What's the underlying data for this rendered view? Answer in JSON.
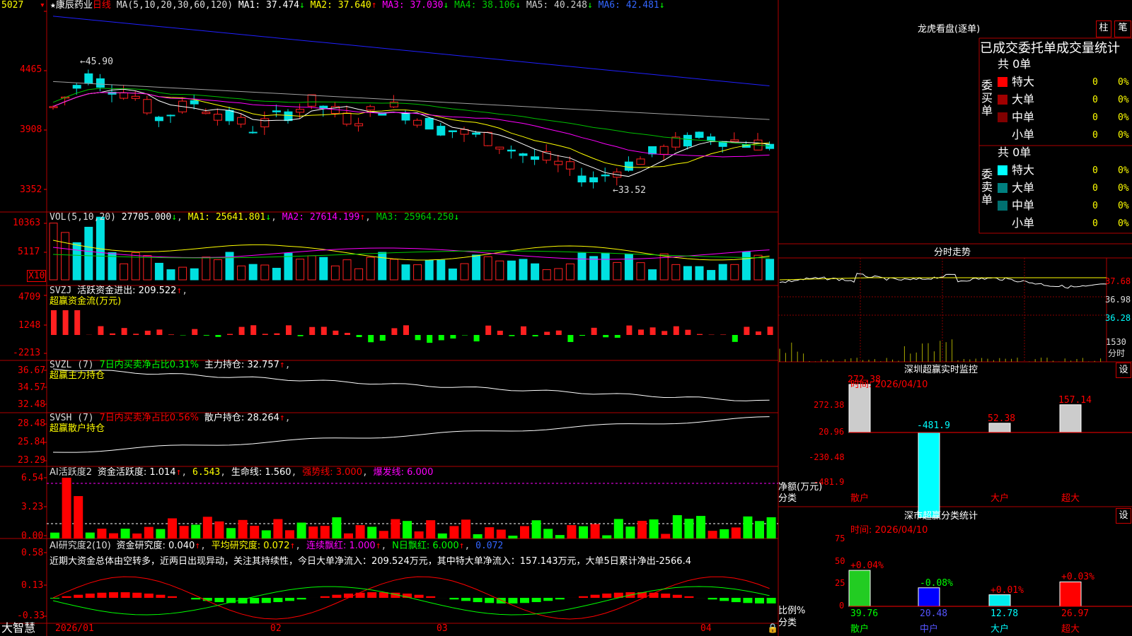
{
  "colors": {
    "up": "#ff2020",
    "down": "#00e0e0",
    "green": "#00ff00",
    "grid": "#b00000",
    "ma1": "#ffffff",
    "ma2": "#ffff00",
    "ma3": "#ff00ff",
    "ma4": "#00c000",
    "ma5": "#a0a0a0",
    "ma6": "#2020ff"
  },
  "header": {
    "star": "★",
    "stock_name": "康辰药业",
    "period": "日线",
    "ma_text": "MA(5,10,20,30,60,120)",
    "ma": [
      {
        "label": "MA1: 37.474",
        "arrow": "↓"
      },
      {
        "label": "MA2: 37.640",
        "arrow": "↑"
      },
      {
        "label": "MA3: 37.030",
        "arrow": "↓"
      },
      {
        "label": "MA4: 38.106",
        "arrow": "↓"
      },
      {
        "label": "MA5: 40.248",
        "arrow": "↓"
      },
      {
        "label": "MA6: 42.481",
        "arrow": "↓"
      }
    ]
  },
  "price_axis": [
    "5027",
    "4465",
    "3908",
    "3352"
  ],
  "price_annotations": {
    "high": "45.90",
    "low": "33.52"
  },
  "vol": {
    "title": "VOL(5,10,20)",
    "value": "27705.000",
    "arrow": "↓",
    "ma1": "MA1: 25641.801",
    "ma2": "MA2: 27614.199",
    "ma3": "MA3: 25964.250",
    "axis": [
      "10363",
      "5117"
    ],
    "unit": "X10"
  },
  "svzj": {
    "title": "SVZJ",
    "text": "活跃资金进出: 209.522",
    "arrow": "↑",
    "sub": "超赢资金流(万元)",
    "axis": [
      "4709",
      "1248",
      "-2213"
    ]
  },
  "svzl": {
    "title": "SVZL (7)",
    "ratio": "7日内买卖净占比0.31%",
    "text": "主力持仓: 32.757",
    "sub": "超赢主力持仓",
    "axis": [
      "36.67",
      "34.57",
      "32.48"
    ]
  },
  "svsh": {
    "title": "SVSH (7)",
    "ratio": "7日内买卖净占比0.56%",
    "text": "散户持仓: 28.264",
    "sub": "超赢散户持仓",
    "axis": [
      "28.48",
      "25.84",
      "23.29"
    ]
  },
  "ai_active": {
    "title": "AI活跃度2",
    "text": "资金活跃度: 1.014",
    "v2": "6.543",
    "life": "生命线: 1.560",
    "strong": "强势线: 3.000",
    "burst": "爆发线: 6.000",
    "axis": [
      "6.54",
      "3.23",
      "0.00"
    ]
  },
  "ai_research": {
    "title": "AI研究度2(10)",
    "text": "资金研究度: 0.040",
    "avg": "平均研究度: 0.072",
    "cont": "连续飘红: 1.000",
    "nday": "N日飘红: 6.000",
    "last": "0.072",
    "axis": [
      "0.58",
      "0.13",
      "-0.33"
    ],
    "comment": "近期大资金总体由空转多，近两日出现异动，关注其持续性，今日大单净流入：209.524万元，其中特大单净流入：157.143万元，大单5日累计净出-2566.4"
  },
  "bottom": {
    "logo": "大智慧",
    "dates": [
      "2026/01",
      "02",
      "03",
      "04"
    ]
  },
  "right": {
    "lhb_title": "龙虎看盘(逐单)",
    "btn_zhu": "柱",
    "btn_bi": "笔",
    "stat_title": "已成交委托单成交量统计",
    "buy": {
      "side": "委买单",
      "total": "共 0单",
      "rows": [
        {
          "name": "特大",
          "v": "0",
          "p": "0%",
          "c": "#ff0000"
        },
        {
          "name": "大单",
          "v": "0",
          "p": "0%",
          "c": "#a00000"
        },
        {
          "name": "中单",
          "v": "0",
          "p": "0%",
          "c": "#800000"
        },
        {
          "name": "小单",
          "v": "0",
          "p": "0%",
          "c": "#000000"
        }
      ]
    },
    "sell": {
      "side": "委卖单",
      "total": "共 0单",
      "rows": [
        {
          "name": "特大",
          "v": "0",
          "p": "0%",
          "c": "#00ffff"
        },
        {
          "name": "大单",
          "v": "0",
          "p": "0%",
          "c": "#008080"
        },
        {
          "name": "中单",
          "v": "0",
          "p": "0%",
          "c": "#007070"
        },
        {
          "name": "小单",
          "v": "0",
          "p": "0%",
          "c": "#000000"
        }
      ]
    },
    "fs_title": "分时走势",
    "fs_axis": [
      "37.68",
      "36.98",
      "36.28"
    ],
    "fs_vol": "1530",
    "fs_unit": "分时",
    "sz_title": "深圳超赢实时监控",
    "btn_set": "设",
    "time": "时间: 2026/04/10",
    "sz_axis": [
      "272.38",
      "20.96",
      "-230.48",
      "-481.9"
    ],
    "sz_unit1": "净额(万元)",
    "sz_unit2": "分类",
    "cls_title": "深市超赢分类统计",
    "cls_axis": [
      "75",
      "50",
      "25",
      "0"
    ],
    "cls_unit1": "比例%",
    "cls_unit2": "分类"
  },
  "chart_data": [
    {
      "type": "bar",
      "title": "深圳超赢实时监控",
      "ylabel": "净额(万元)",
      "xlabel": "分类",
      "categories": [
        "散户",
        "中户",
        "大户",
        "超大"
      ],
      "values": [
        272.38,
        -481.9,
        52.38,
        157.14
      ]
    },
    {
      "type": "bar",
      "title": "深市超赢分类统计",
      "ylabel": "比例%",
      "xlabel": "分类",
      "categories": [
        "散户",
        "中户",
        "大户",
        "超大"
      ],
      "values": [
        39.76,
        20.48,
        12.78,
        26.97
      ],
      "change": [
        "+0.04%",
        "-0.08%",
        "+0.01%",
        "+0.03%"
      ]
    }
  ]
}
